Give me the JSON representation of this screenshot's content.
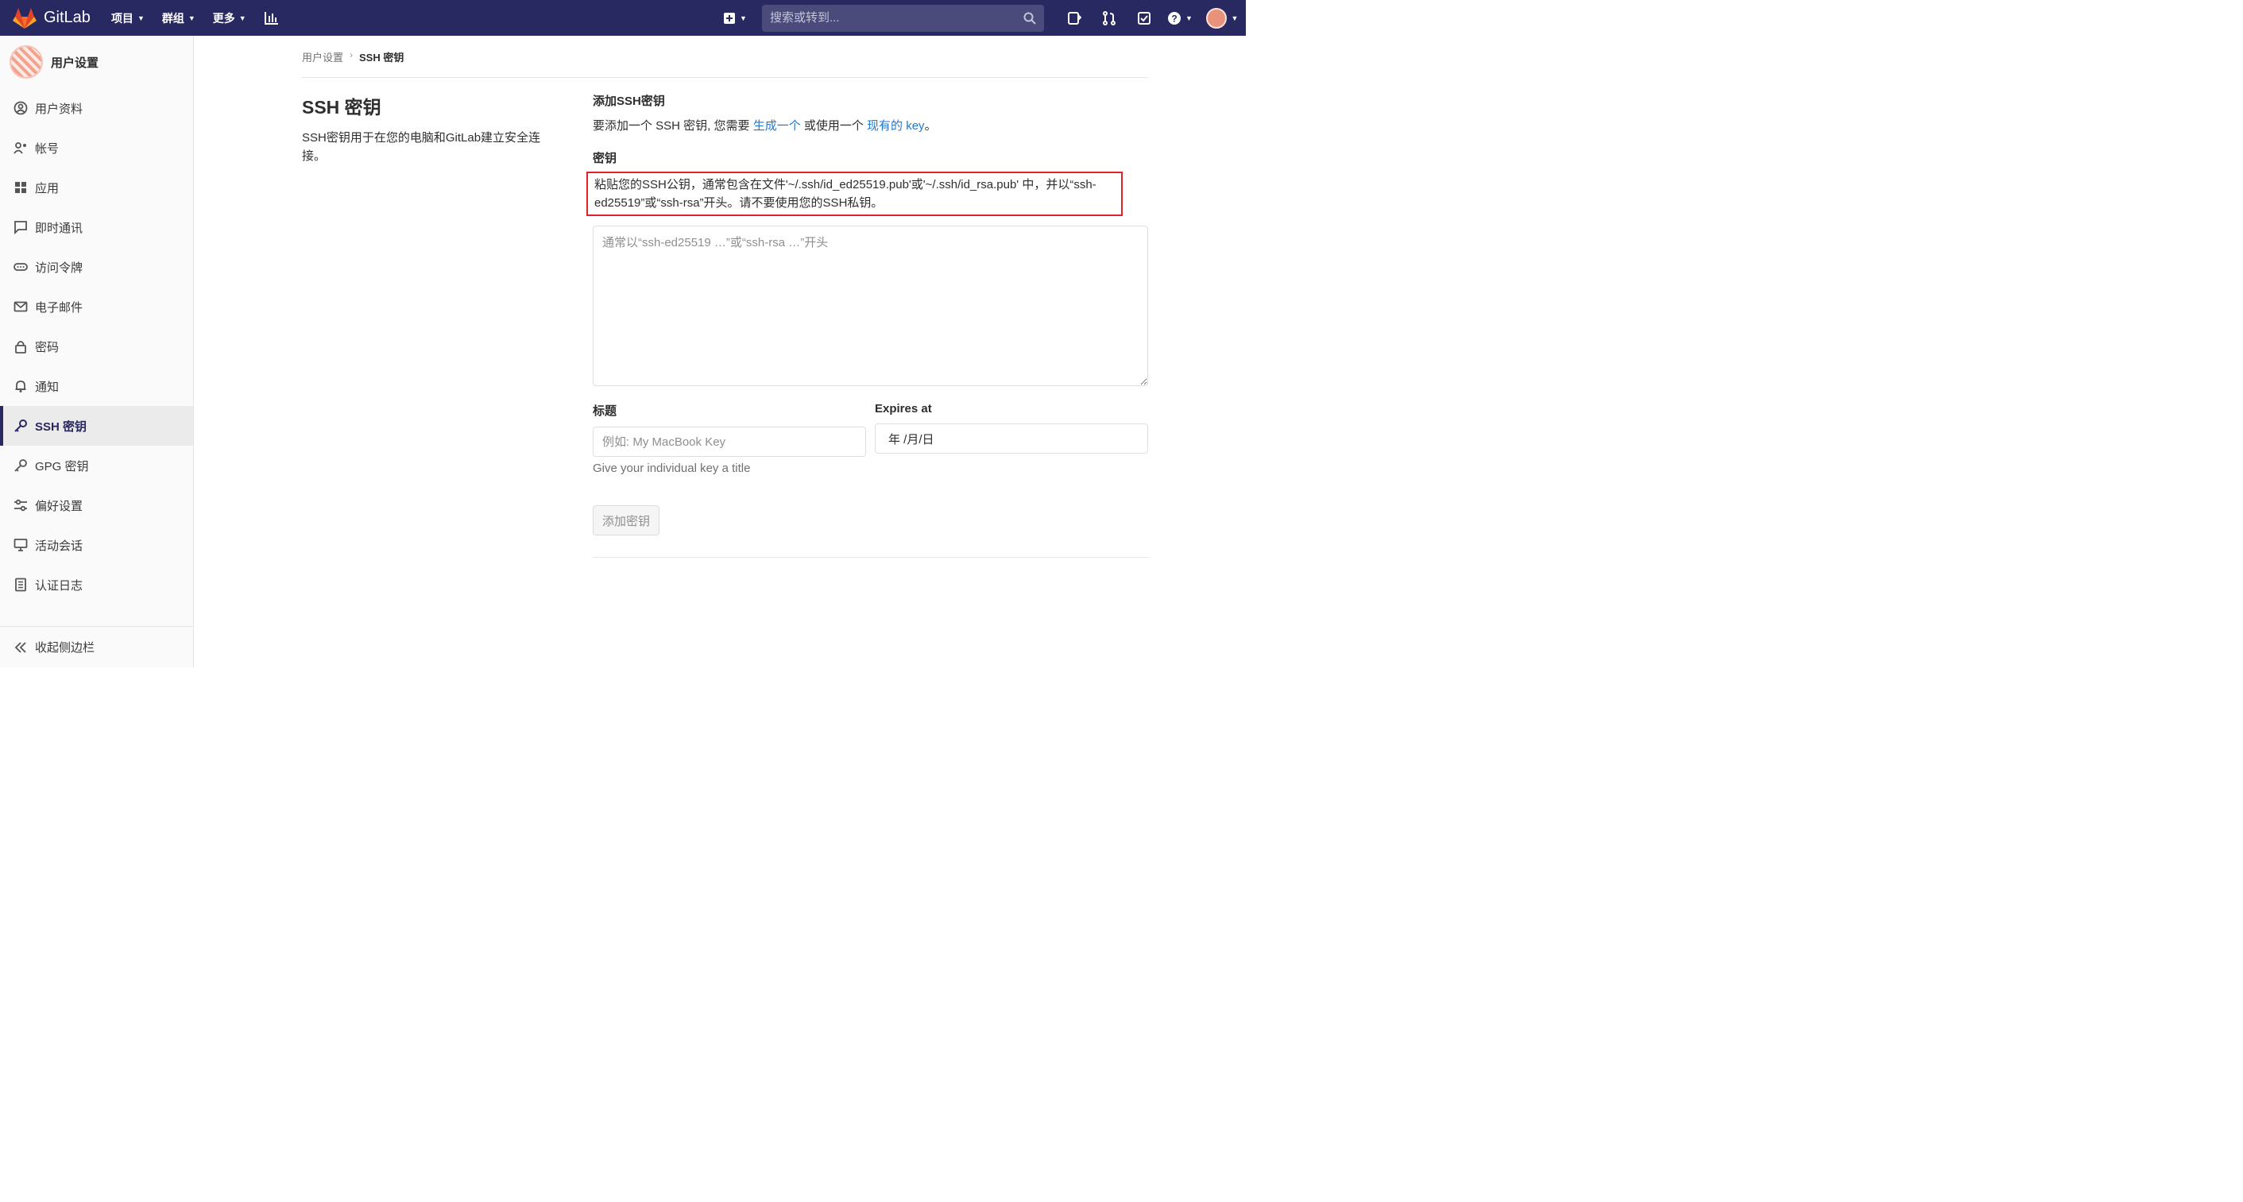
{
  "topbar": {
    "brand": "GitLab",
    "menu": [
      {
        "label": "项目"
      },
      {
        "label": "群组"
      },
      {
        "label": "更多"
      }
    ],
    "search_placeholder": "搜索或转到..."
  },
  "sidebar": {
    "title": "用户设置",
    "items": [
      {
        "label": "用户资料",
        "icon": "profile-icon"
      },
      {
        "label": "帐号",
        "icon": "account-icon"
      },
      {
        "label": "应用",
        "icon": "applications-icon"
      },
      {
        "label": "即时通讯",
        "icon": "chat-icon"
      },
      {
        "label": "访问令牌",
        "icon": "token-icon"
      },
      {
        "label": "电子邮件",
        "icon": "mail-icon"
      },
      {
        "label": "密码",
        "icon": "lock-icon"
      },
      {
        "label": "通知",
        "icon": "bell-icon"
      },
      {
        "label": "SSH 密钥",
        "icon": "key-icon",
        "active": true
      },
      {
        "label": "GPG 密钥",
        "icon": "key-icon"
      },
      {
        "label": "偏好设置",
        "icon": "preferences-icon"
      },
      {
        "label": "活动会话",
        "icon": "monitor-icon"
      },
      {
        "label": "认证日志",
        "icon": "log-icon"
      }
    ],
    "collapse_label": "收起侧边栏"
  },
  "breadcrumb": {
    "parent": "用户设置",
    "current": "SSH 密钥"
  },
  "left": {
    "heading": "SSH 密钥",
    "description": "SSH密钥用于在您的电脑和GitLab建立安全连接。"
  },
  "form": {
    "add_heading": "添加SSH密钥",
    "intro_pre": "要添加一个 SSH 密钥, 您需要 ",
    "intro_link1": "生成一个",
    "intro_mid": " 或使用一个 ",
    "intro_link2": "现有的 key",
    "intro_post": "。",
    "key_label": "密钥",
    "key_hint": "粘贴您的SSH公钥，通常包含在文件'~/.ssh/id_ed25519.pub'或'~/.ssh/id_rsa.pub' 中，并以“ssh-ed25519”或“ssh-rsa”开头。请不要使用您的SSH私钥。",
    "key_placeholder": "通常以“ssh-ed25519 …”或“ssh-rsa …”开头",
    "title_label": "标题",
    "title_placeholder": "例如: My MacBook Key",
    "expires_label": "Expires at",
    "expires_value": "年 /月/日",
    "title_help": "Give your individual key a title",
    "submit_label": "添加密钥"
  },
  "colors": {
    "nav_bg": "#292961",
    "link": "#1f78d1",
    "highlight_border": "#e0222a"
  }
}
